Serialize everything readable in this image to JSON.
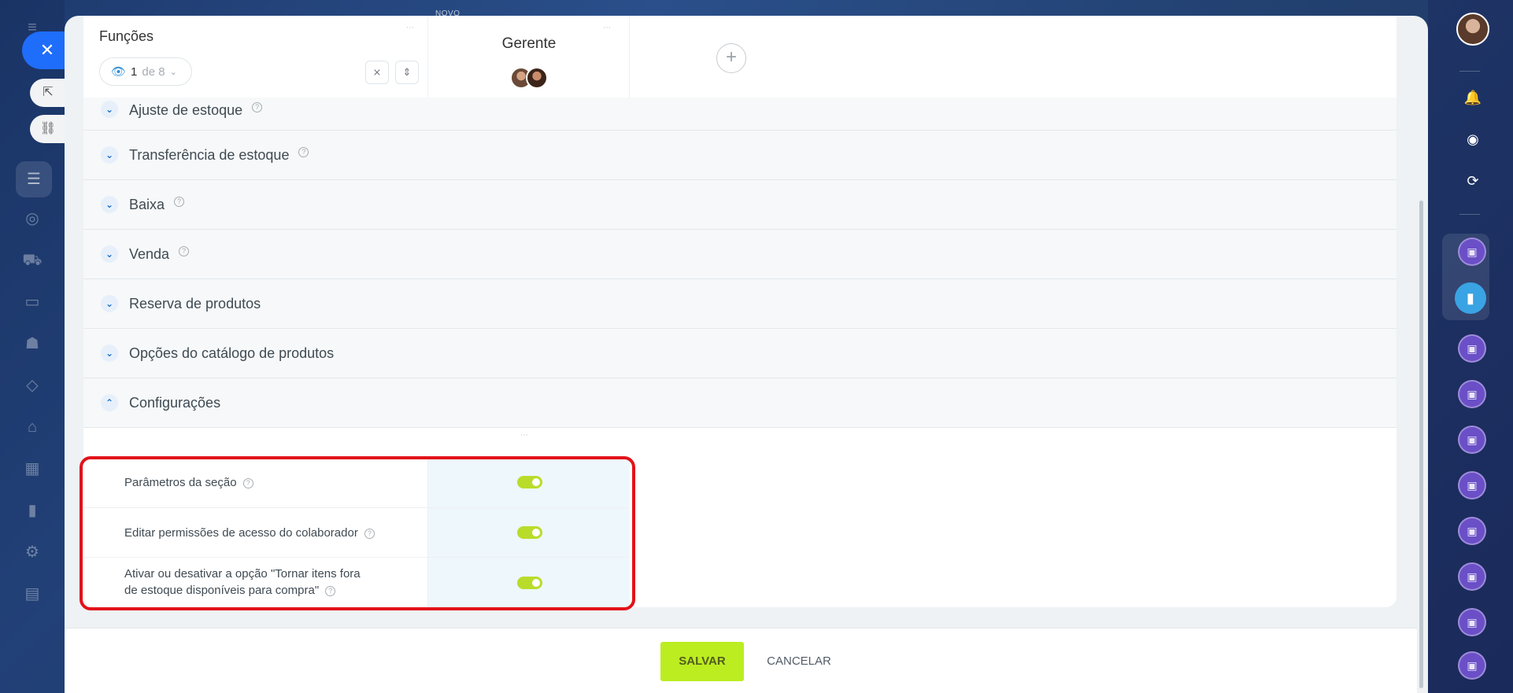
{
  "header": {
    "new_badge": "NOVO",
    "functions_title": "Funções",
    "pager": {
      "current": "1",
      "of_text": "de 8"
    },
    "role_column": "Gerente",
    "add_column_symbol": "+"
  },
  "sections": [
    {
      "label": "Ajuste de estoque",
      "expanded": false,
      "has_help": true
    },
    {
      "label": "Transferência de estoque",
      "expanded": false,
      "has_help": true
    },
    {
      "label": "Baixa",
      "expanded": false,
      "has_help": true
    },
    {
      "label": "Venda",
      "expanded": false,
      "has_help": true
    },
    {
      "label": "Reserva de produtos",
      "expanded": false,
      "has_help": false
    },
    {
      "label": "Opções do catálogo de produtos",
      "expanded": false,
      "has_help": false
    },
    {
      "label": "Configurações",
      "expanded": true,
      "has_help": false
    }
  ],
  "settings": [
    {
      "label": "Parâmetros da seção",
      "enabled": true
    },
    {
      "label": "Editar permissões de acesso do colaborador",
      "enabled": true
    },
    {
      "label_line1": "Ativar ou desativar a opção \"Tornar itens fora",
      "label_line2": "de estoque disponíveis para compra\"",
      "enabled": true
    }
  ],
  "footer": {
    "save_label": "SALVAR",
    "cancel_label": "CANCELAR"
  },
  "colors": {
    "accent_green": "#bbed21",
    "switch_on": "#b9dc2b",
    "highlight_red": "#e2131a",
    "link_blue": "#1e6fc8"
  },
  "icons": {
    "close": "close-icon",
    "open_external": "external-link-icon",
    "copy_link": "link-icon",
    "eye": "eye-icon",
    "collapse_all": "collapse-icon",
    "expand_all": "expand-icon",
    "help": "help-icon",
    "bell": "bell-icon"
  }
}
